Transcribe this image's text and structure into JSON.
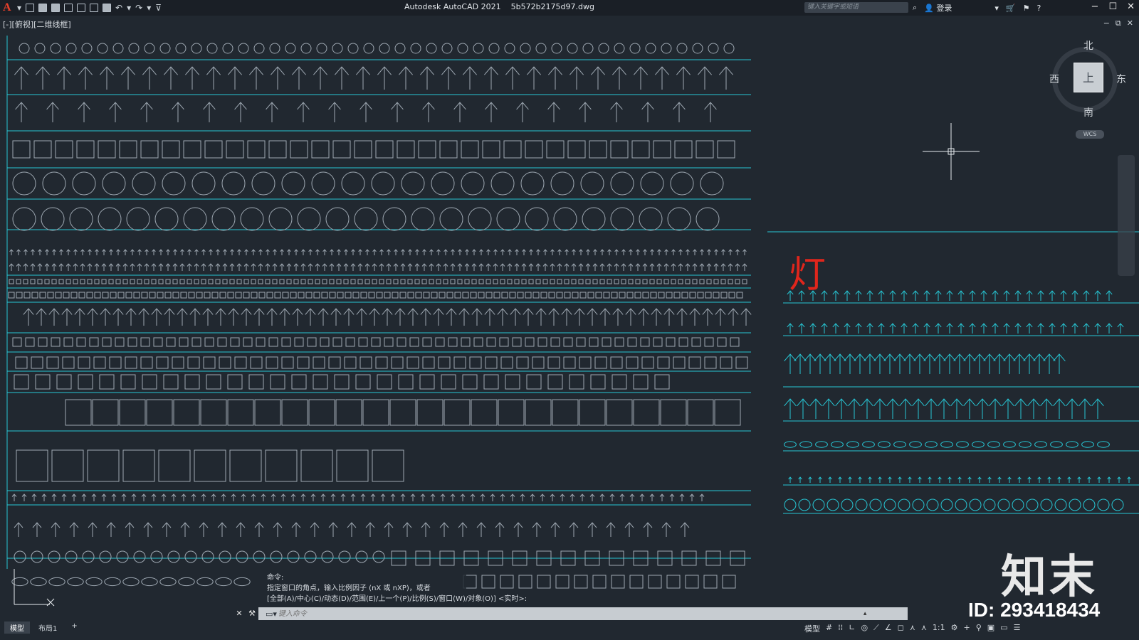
{
  "titlebar": {
    "app_name": "Autodesk AutoCAD 2021",
    "file_name": "5b572b2175d97.dwg",
    "search_placeholder": "键入关键字或短语",
    "login": "登录"
  },
  "viewport": {
    "label": "[-][俯视][二维线框]"
  },
  "viewcube": {
    "north": "北",
    "south": "南",
    "east": "东",
    "west": "西",
    "face": "上",
    "wcs": "WCS"
  },
  "drawing": {
    "lamp_label": "灯",
    "line_color": "#27c6d4",
    "block_color": "#9ea8b2",
    "lamp_color": "#e0261c"
  },
  "command": {
    "history": [
      "命令:",
      "指定窗口的角点，输入比例因子 (nX 或 nXP)，或者",
      "[全部(A)/中心(C)/动态(D)/范围(E)/上一个(P)/比例(S)/窗口(W)/对象(O)] <实时>:"
    ],
    "placeholder": "键入命令"
  },
  "layout_tabs": [
    "模型",
    "布局1"
  ],
  "add_tab": "+",
  "statusbar": {
    "model": "模型",
    "scale": "1:1"
  },
  "watermark": {
    "brand": "知末",
    "id": "ID: 293418434"
  }
}
